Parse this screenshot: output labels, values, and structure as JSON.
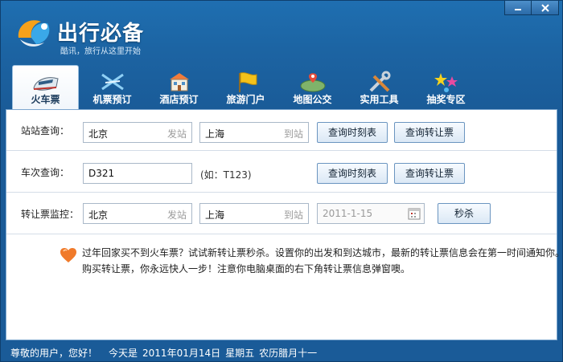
{
  "app": {
    "title": "出行必备",
    "subtitle": "酷讯，旅行从这里开始"
  },
  "window_controls": {
    "minimize_icon": "minimize-icon",
    "close_icon": "close-icon"
  },
  "tabs": [
    {
      "label": "火车票",
      "icon": "train-icon",
      "active": true
    },
    {
      "label": "机票预订",
      "icon": "airplane-icon",
      "active": false
    },
    {
      "label": "酒店预订",
      "icon": "hotel-icon",
      "active": false
    },
    {
      "label": "旅游门户",
      "icon": "flag-icon",
      "active": false
    },
    {
      "label": "地图公交",
      "icon": "map-icon",
      "active": false
    },
    {
      "label": "实用工具",
      "icon": "tools-icon",
      "active": false
    },
    {
      "label": "抽奖专区",
      "icon": "stars-icon",
      "active": false
    }
  ],
  "station_query": {
    "label": "站站查询：",
    "from_value": "北京",
    "from_hint": "发站",
    "to_value": "上海",
    "to_hint": "到站",
    "btn_timetable": "查询时刻表",
    "btn_transfer": "查询转让票"
  },
  "train_query": {
    "label": "车次查询：",
    "train_value": "D321",
    "example": "(如：T123)",
    "btn_timetable": "查询时刻表",
    "btn_transfer": "查询转让票"
  },
  "transfer_monitor": {
    "label": "转让票监控：",
    "from_value": "北京",
    "from_hint": "发站",
    "to_value": "上海",
    "to_hint": "到站",
    "date_value": "2011-1-15",
    "btn_seckill": "秒杀"
  },
  "notice": {
    "text": "过年回家买不到火车票？试试新转让票秒杀。设置你的出发和到达城市，最新的转让票信息会在第一时间通知你。购买转让票，你永远快人一步！注意你电脑桌面的右下角转让票信息弹窗噢。"
  },
  "status_bar": {
    "greeting": "尊敬的用户，您好！",
    "today": "今天是",
    "date": "2011年01月14日",
    "weekday": "星期五",
    "lunar": "农历腊月十一"
  },
  "colors": {
    "frame_blue": "#1c64a3",
    "panel_border": "#7da7cf",
    "button_border": "#6b95c0"
  }
}
